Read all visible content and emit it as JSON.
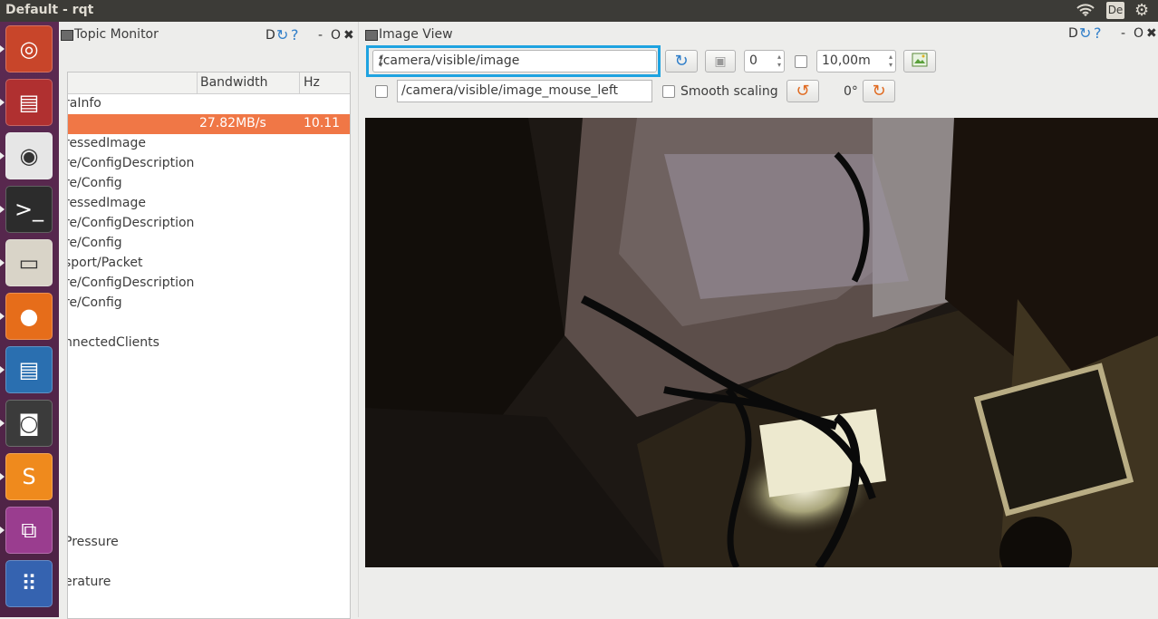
{
  "window_title": "Default - rqt",
  "top_indicators": {
    "keyboard": "De"
  },
  "launcher": {
    "items": [
      {
        "name": "ubuntu-dash-icon",
        "glyph": "◎",
        "color": "#c8452a"
      },
      {
        "name": "rqt-icon",
        "glyph": "▤",
        "color": "#b03030"
      },
      {
        "name": "chrome-icon",
        "glyph": "◉",
        "color": "#e6e6e6"
      },
      {
        "name": "terminal-icon",
        "glyph": ">_",
        "color": "#2c2c2c"
      },
      {
        "name": "files-icon",
        "glyph": "▭",
        "color": "#d9d4c8"
      },
      {
        "name": "firefox-icon",
        "glyph": "●",
        "color": "#e66d1a"
      },
      {
        "name": "writer-icon",
        "glyph": "▤",
        "color": "#2a6fb0"
      },
      {
        "name": "webcam-icon",
        "glyph": "◙",
        "color": "#3b3b3b"
      },
      {
        "name": "sublime-icon",
        "glyph": "S",
        "color": "#ef8a1d"
      },
      {
        "name": "network-icon",
        "glyph": "⧉",
        "color": "#9a3d8f"
      },
      {
        "name": "apps-grid-icon",
        "glyph": "⠿",
        "color": "#3563b0"
      }
    ]
  },
  "topic_monitor": {
    "title": "Topic Monitor",
    "dock_buttons": [
      "D",
      "-",
      "O"
    ],
    "columns": {
      "bandwidth": "Bandwidth",
      "hz": "Hz"
    },
    "rows": [
      {
        "topic": "raInfo",
        "bandwidth": "",
        "hz": ""
      },
      {
        "topic": "",
        "bandwidth": "27.82MB/s",
        "hz": "10.11",
        "selected": true
      },
      {
        "topic": "ressedImage",
        "bandwidth": "",
        "hz": ""
      },
      {
        "topic": "re/ConfigDescription",
        "bandwidth": "",
        "hz": ""
      },
      {
        "topic": "re/Config",
        "bandwidth": "",
        "hz": ""
      },
      {
        "topic": "ressedImage",
        "bandwidth": "",
        "hz": ""
      },
      {
        "topic": "re/ConfigDescription",
        "bandwidth": "",
        "hz": ""
      },
      {
        "topic": "re/Config",
        "bandwidth": "",
        "hz": ""
      },
      {
        "topic": "sport/Packet",
        "bandwidth": "",
        "hz": ""
      },
      {
        "topic": "re/ConfigDescription",
        "bandwidth": "",
        "hz": ""
      },
      {
        "topic": "re/Config",
        "bandwidth": "",
        "hz": ""
      },
      {
        "topic": "",
        "bandwidth": "",
        "hz": ""
      },
      {
        "topic": "nnectedClients",
        "bandwidth": "",
        "hz": ""
      },
      {
        "topic": "Pressure",
        "bandwidth": "",
        "hz": ""
      },
      {
        "topic": "erature",
        "bandwidth": "",
        "hz": ""
      }
    ]
  },
  "image_view": {
    "title": "Image View",
    "dock_buttons": [
      "D",
      "-",
      "O"
    ],
    "topic_combo": "/camera/visible/image",
    "refresh_icon": "refresh-icon",
    "zoom_value": "0",
    "timeout_value": "10,00m",
    "mouse_topic": "/camera/visible/image_mouse_left",
    "smooth_scaling_label": "Smooth scaling",
    "rotation_label": "0°"
  },
  "colors": {
    "selection": "#f07746",
    "highlight": "#1fa3e0",
    "launcher_bg": "#5c2a52",
    "topbar_bg": "#3c3b37"
  }
}
